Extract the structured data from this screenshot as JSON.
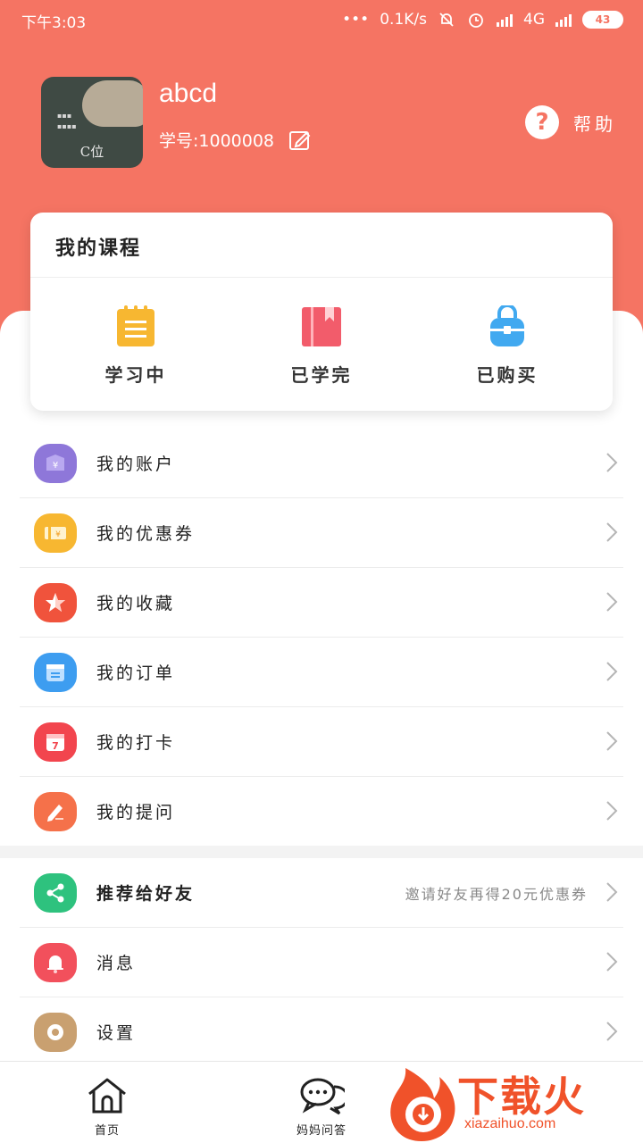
{
  "status_bar": {
    "time": "下午3:03",
    "net_speed": "0.1K/s",
    "network": "4G",
    "battery": "43"
  },
  "profile": {
    "username": "abcd",
    "student_id_label": "学号:1000008",
    "avatar_caption": "C位",
    "help_label": "帮助"
  },
  "courses": {
    "title": "我的课程",
    "items": [
      {
        "label": "学习中",
        "icon": "notepad-icon",
        "color": "#f7b731"
      },
      {
        "label": "已学完",
        "icon": "book-icon",
        "color": "#f25c6b"
      },
      {
        "label": "已购买",
        "icon": "bag-icon",
        "color": "#41a9f0"
      }
    ]
  },
  "menu": [
    {
      "label": "我的账户",
      "icon": "wallet-icon",
      "color": "#8e77d9"
    },
    {
      "label": "我的优惠券",
      "icon": "coupon-icon",
      "color": "#f7b731"
    },
    {
      "label": "我的收藏",
      "icon": "star-icon",
      "color": "#f0533c"
    },
    {
      "label": "我的订单",
      "icon": "calendar-list-icon",
      "color": "#3d9df0"
    },
    {
      "label": "我的打卡",
      "icon": "calendar-7-icon",
      "color": "#f2454e"
    },
    {
      "label": "我的提问",
      "icon": "pencil-icon",
      "color": "#f5714a"
    }
  ],
  "menu2": [
    {
      "label": "推荐给好友",
      "icon": "share-icon",
      "color": "#2ec27e",
      "hint": "邀请好友再得20元优惠券"
    },
    {
      "label": "消息",
      "icon": "bell-icon",
      "color": "#f2505c"
    },
    {
      "label": "设置",
      "icon": "gear-icon",
      "color": "#c9a070"
    }
  ],
  "bottom_nav": [
    {
      "label": "首页",
      "icon": "home-icon"
    },
    {
      "label": "妈妈问答",
      "icon": "chat-icon"
    }
  ],
  "watermark": {
    "text": "下载火",
    "url": "xiazaihuo.com"
  }
}
